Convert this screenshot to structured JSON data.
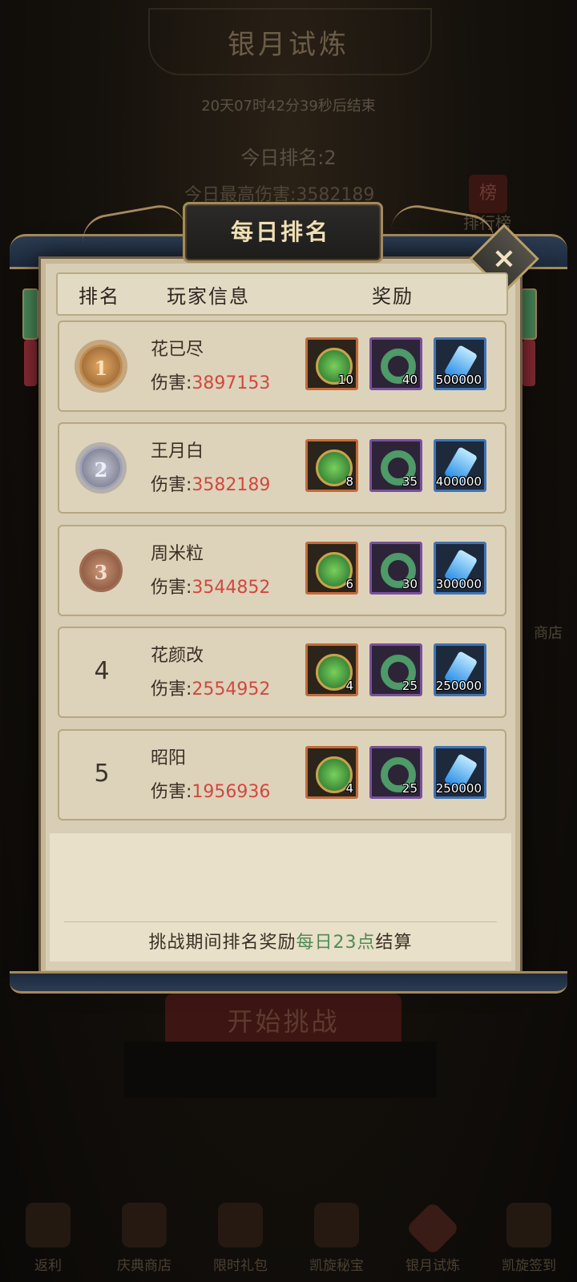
{
  "background": {
    "title": "银月试炼",
    "countdown": "20天07时42分39秒后结束",
    "today_rank": "今日排名:2",
    "today_best": "今日最高伤害:3582189",
    "ranking_icon": "榜",
    "ranking_label": "排行榜",
    "side_label": "商店",
    "start_button": "开始挑战",
    "nav": [
      "返利",
      "庆典商店",
      "限时礼包",
      "凯旋秘宝",
      "银月试炼",
      "凯旋签到"
    ]
  },
  "dialog": {
    "title": "每日排名",
    "close_icon": "×",
    "headers": {
      "rank": "排名",
      "player": "玩家信息",
      "reward": "奖励"
    },
    "damage_label": "伤害:",
    "rows": [
      {
        "rank": "1",
        "medal": "gold",
        "name": "花已尽",
        "damage": "3897153",
        "rewards": [
          "10",
          "40",
          "500000"
        ]
      },
      {
        "rank": "2",
        "medal": "silver",
        "name": "王月白",
        "damage": "3582189",
        "rewards": [
          "8",
          "35",
          "400000"
        ]
      },
      {
        "rank": "3",
        "medal": "bronze",
        "name": "周米粒",
        "damage": "3544852",
        "rewards": [
          "6",
          "30",
          "300000"
        ]
      },
      {
        "rank": "4",
        "medal": "",
        "name": "花颜改",
        "damage": "2554952",
        "rewards": [
          "4",
          "25",
          "250000"
        ]
      },
      {
        "rank": "5",
        "medal": "",
        "name": "昭阳",
        "damage": "1956936",
        "rewards": [
          "4",
          "25",
          "250000"
        ]
      }
    ],
    "my_entry": {
      "rank": "2",
      "name": "王月白",
      "damage": "3582189",
      "rewards": [
        "8",
        "35",
        "400000"
      ]
    },
    "footer": {
      "prefix": "挑战期间排名奖励",
      "highlight": "每日23点",
      "suffix": "结算"
    },
    "colors": {
      "damage": "#d3473f",
      "highlight": "#4f8a58"
    }
  }
}
